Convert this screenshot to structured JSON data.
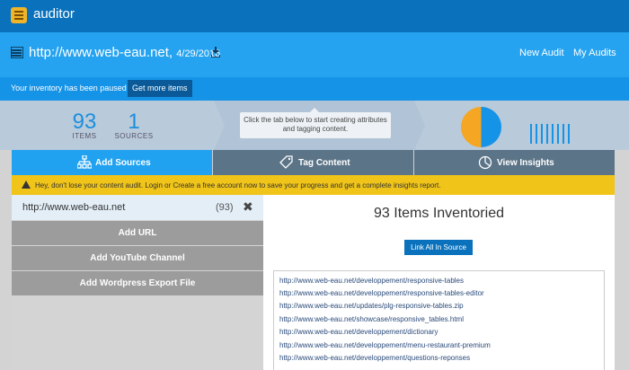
{
  "topbar": {
    "app_name": "auditor"
  },
  "header": {
    "url": "http://www.web-eau.net,",
    "date": "4/29/2016",
    "new_audit": "New Audit",
    "my_audits": "My Audits"
  },
  "notice": {
    "text": "Your inventory has been paused",
    "button": "Get more items"
  },
  "stats": {
    "items_count": "93",
    "items_label": "ITEMS",
    "sources_count": "1",
    "sources_label": "SOURCES",
    "tooltip": "Click the tab below to start creating attributes and tagging content."
  },
  "tabs": {
    "add_sources": "Add Sources",
    "tag_content": "Tag Content",
    "view_insights": "View Insights"
  },
  "warning": {
    "text": "Hey, don't lose your content audit. Login or Create a free account now to save your progress and get a complete insights report."
  },
  "sources": {
    "url": "http://www.web-eau.net",
    "count": "(93)",
    "add_url": "Add URL",
    "add_youtube": "Add YouTube Channel",
    "add_wordpress": "Add Wordpress Export File"
  },
  "inventory": {
    "title": "93 Items Inventoried",
    "link_all": "Link All In Source",
    "urls": [
      "http://www.web-eau.net/developpement/responsive-tables",
      "http://www.web-eau.net/developpement/responsive-tables-editor",
      "http://www.web-eau.net/updates/plg-responsive-tables.zip",
      "http://www.web-eau.net/showcase/responsive_tables.html",
      "http://www.web-eau.net/developpement/dictionary",
      "http://www.web-eau.net/developpement/menu-restaurant-premium",
      "http://www.web-eau.net/developpement/questions-reponses"
    ]
  },
  "colors": {
    "brand": "#0a72bd",
    "accent": "#21a2f0",
    "warning": "#f0c419",
    "pie_orange": "#f5a623",
    "pie_blue": "#1593e6"
  }
}
